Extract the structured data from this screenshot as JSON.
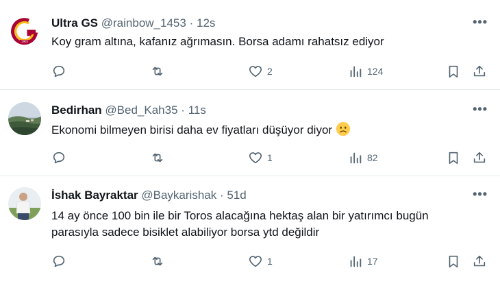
{
  "tweets": [
    {
      "name": "Ultra GS",
      "handle": "@rainbow_1453",
      "separator": "·",
      "time": "12s",
      "text": "Koy gram altına, kafanız ağrımasın. Borsa adamı rahatsız ediyor",
      "likes": "2",
      "views": "124",
      "avatar": "galatasaray-logo"
    },
    {
      "name": "Bedirhan",
      "handle": "@Bed_Kah35",
      "separator": "·",
      "time": "11s",
      "text": "Ekonomi bilmeyen birisi daha ev fiyatları düşüyor diyor",
      "emoji": "frowning-face-emoji",
      "likes": "1",
      "views": "82",
      "avatar": "landscape-photo"
    },
    {
      "name": "İshak Bayraktar",
      "handle": "@Baykarishak",
      "separator": "·",
      "time": "51d",
      "text_line1": "14 ay önce 100 bin ile bir Toros alacağına hektaş alan bir yatırımcı bugün",
      "text_line2": "parasıyla sadece bisiklet alabiliyor borsa ytd değildir",
      "likes": "1",
      "views": "17",
      "avatar": "person-photo"
    }
  ],
  "more_icon": "•••",
  "colors": {
    "text": "#0f1419",
    "muted": "#536471",
    "divider": "#e6ecf0",
    "brand_red": "#a90432",
    "brand_yellow": "#fdb912"
  }
}
